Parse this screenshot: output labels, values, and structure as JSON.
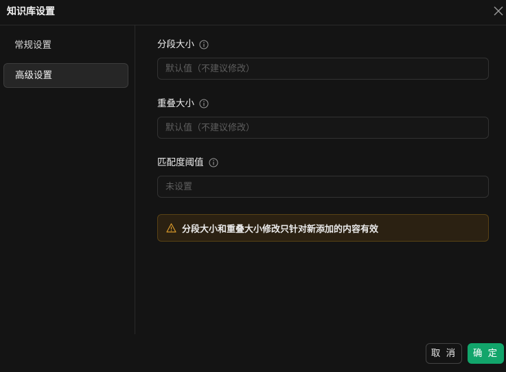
{
  "dialog": {
    "title": "知识库设置"
  },
  "sidebar": {
    "items": [
      {
        "label": "常规设置",
        "active": false
      },
      {
        "label": "高级设置",
        "active": true
      }
    ]
  },
  "fields": [
    {
      "label": "分段大小",
      "value": "",
      "placeholder": "默认值（不建议修改）"
    },
    {
      "label": "重叠大小",
      "value": "",
      "placeholder": "默认值（不建议修改）"
    },
    {
      "label": "匹配度阈值",
      "value": "",
      "placeholder": "未设置"
    }
  ],
  "alert": {
    "text": "分段大小和重叠大小修改只针对新添加的内容有效",
    "icon": "warning-icon",
    "color": "#d99a2b"
  },
  "footer": {
    "cancel_label": "取 消",
    "ok_label": "确 定"
  },
  "colors": {
    "accent": "#12a56b",
    "warning_bg": "#2b2112",
    "warning_border": "#594214"
  }
}
